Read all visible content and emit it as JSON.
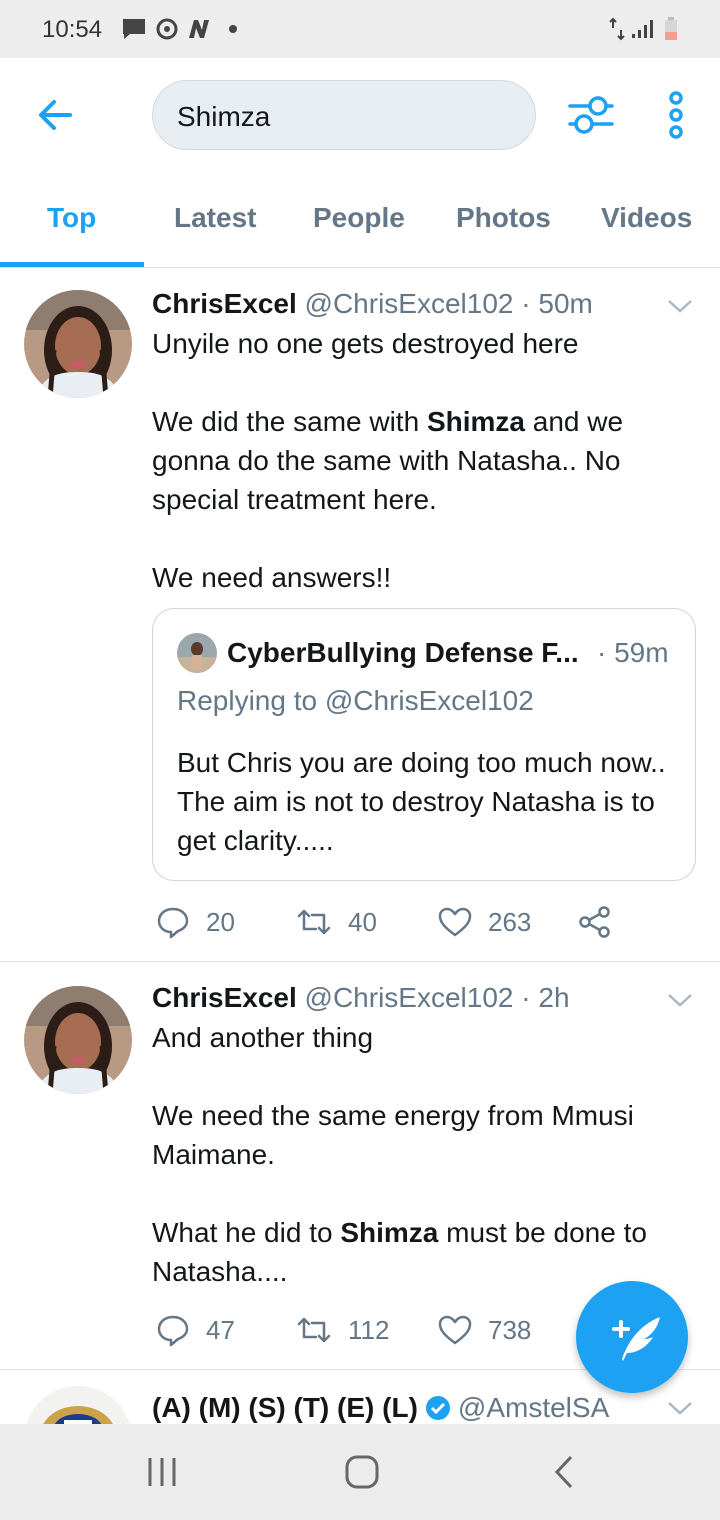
{
  "status_bar": {
    "time": "10:54",
    "left_icons": [
      "message-icon",
      "sync-icon",
      "news-icon",
      "dot-icon"
    ],
    "right_icons": [
      "data-arrows-icon",
      "signal-icon",
      "battery-low-icon"
    ],
    "battery_color": "#f0a090"
  },
  "header": {
    "search_value": "Shimza",
    "icons": [
      "back-arrow-icon",
      "filter-sliders-icon",
      "more-vertical-icon"
    ],
    "accent_color": "#1da1f2"
  },
  "tabs": [
    {
      "label": "Top",
      "active": true
    },
    {
      "label": "Latest",
      "active": false
    },
    {
      "label": "People",
      "active": false
    },
    {
      "label": "Photos",
      "active": false
    },
    {
      "label": "Videos",
      "active": false
    }
  ],
  "tweets": [
    {
      "name": "ChrisExcel",
      "handle": "@ChrisExcel102",
      "time": "· 50m",
      "line1": "Unyile no one gets destroyed here",
      "line2_pre": "We did the same with ",
      "line2_bold": "Shimza",
      "line2_post": " and we gonna do the same with Natasha.. No special treatment here.",
      "line3": "We need answers!!",
      "quote": {
        "name": "CyberBullying Defense F...",
        "time": "· 59m",
        "replying": "Replying to @ChrisExcel102",
        "body": "But Chris you are doing too much now.. The aim is not to destroy Natasha is to get clarity....."
      },
      "replies": "20",
      "retweets": "40",
      "likes": "263"
    },
    {
      "name": "ChrisExcel",
      "handle": "@ChrisExcel102",
      "time": "· 2h",
      "line1": "And another thing",
      "line2": "We need the same energy from Mmusi Maimane.",
      "line3_pre": "What he did to ",
      "line3_bold": "Shimza",
      "line3_post": " must be done to Natasha....",
      "replies": "47",
      "retweets": "112",
      "likes": "738"
    },
    {
      "name": "(A) (M) (S) (T) (E) (L)",
      "handle": "@AmstelSA",
      "verified": true
    }
  ],
  "fab": {
    "icon": "compose-feather-icon"
  },
  "nav_bar": {
    "icons": [
      "recents-icon",
      "home-icon",
      "back-icon"
    ]
  }
}
